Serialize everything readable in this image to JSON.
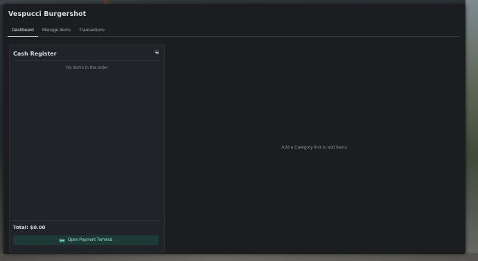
{
  "app": {
    "title": "Vespucci Burgershot"
  },
  "tabs": [
    {
      "label": "Dashboard",
      "active": true
    },
    {
      "label": "Manage Items",
      "active": false
    },
    {
      "label": "Transactions",
      "active": false
    }
  ],
  "cash_register": {
    "title": "Cash Register",
    "menu_icon": "list-icon",
    "empty_text": "No items in the order",
    "total_label": "Total: $0.00",
    "pay_button": {
      "label": "Open Payment Terminal",
      "icon": "credit-card-icon"
    }
  },
  "items_panel": {
    "empty_text": "Add a Category first to add items"
  },
  "colors": {
    "window_bg": "#1c1d21",
    "panel_bg": "#202328",
    "accent": "#8fe0c9",
    "button_bg": "#1d3a35"
  }
}
